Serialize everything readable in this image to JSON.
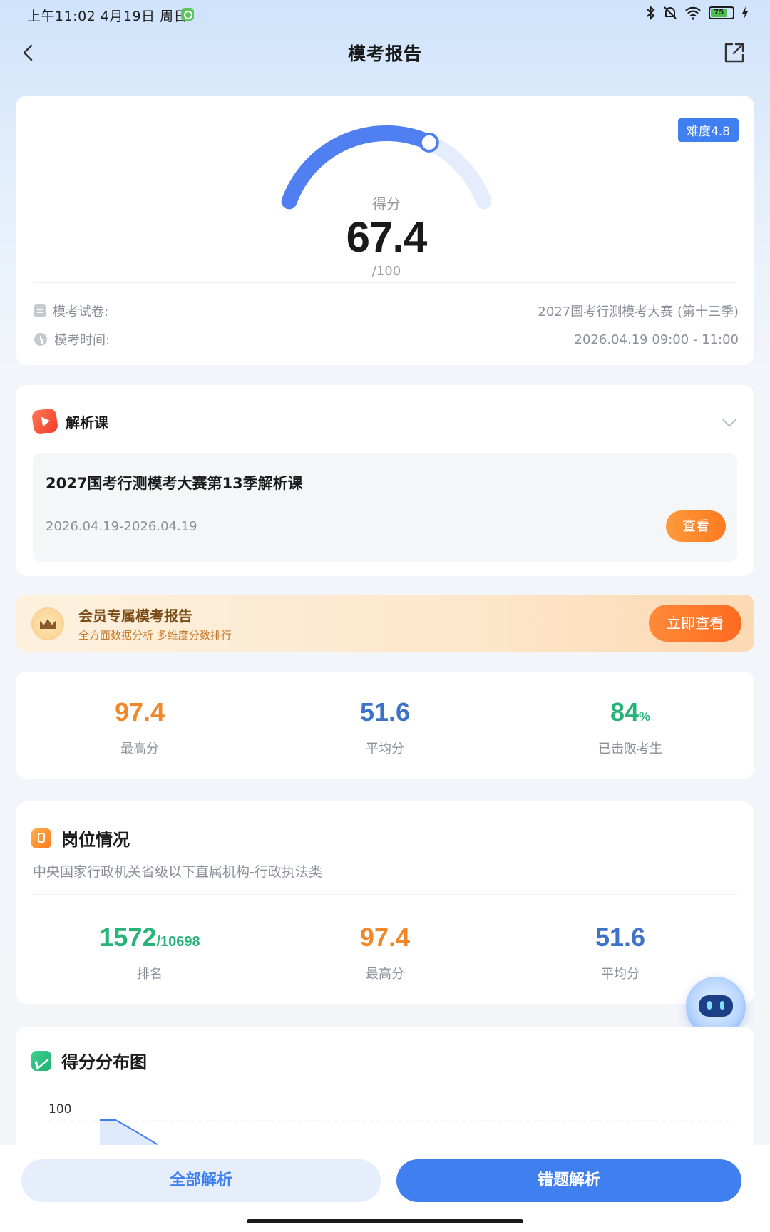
{
  "status_bar": {
    "time_date": "上午11:02  4月19日 周日",
    "battery_level": "75",
    "icons": [
      "bluetooth-icon",
      "mute-icon",
      "wifi-icon",
      "battery-icon",
      "charging-icon"
    ]
  },
  "header": {
    "title": "模考报告"
  },
  "score": {
    "difficulty": "难度4.8",
    "label": "得分",
    "value": "67.4",
    "total": "/100",
    "progress": 0.674,
    "accent": "#4f7ff0"
  },
  "exam_info": {
    "paper_label": "模考试卷:",
    "paper_value": "2027国考行测模考大赛 (第十三季)",
    "time_label": "模考时间:",
    "time_value": "2026.04.19 09:00 - 11:00"
  },
  "course": {
    "section_title": "解析课",
    "title": "2027国考行测模考大赛第13季解析课",
    "dates": "2026.04.19-2026.04.19",
    "view_button": "查看"
  },
  "member": {
    "title": "会员专属模考报告",
    "subtitle": "全方面数据分析 多维度分数排行",
    "button": "立即查看"
  },
  "stats": {
    "highest_value": "97.4",
    "highest_label": "最高分",
    "average_value": "51.6",
    "average_label": "平均分",
    "beat_value": "84",
    "beat_unit": "%",
    "beat_label": "已击败考生"
  },
  "position": {
    "title": "岗位情况",
    "subtitle": "中央国家行政机关省级以下直属机构-行政执法类",
    "rank_value": "1572",
    "rank_total": "/10698",
    "rank_label": "排名",
    "highest_value": "97.4",
    "highest_label": "最高分",
    "average_value": "51.6",
    "average_label": "平均分"
  },
  "distribution": {
    "title": "得分分布图",
    "y_tick": "100"
  },
  "bottom": {
    "all_analysis": "全部解析",
    "wrong_analysis": "错题解析"
  }
}
